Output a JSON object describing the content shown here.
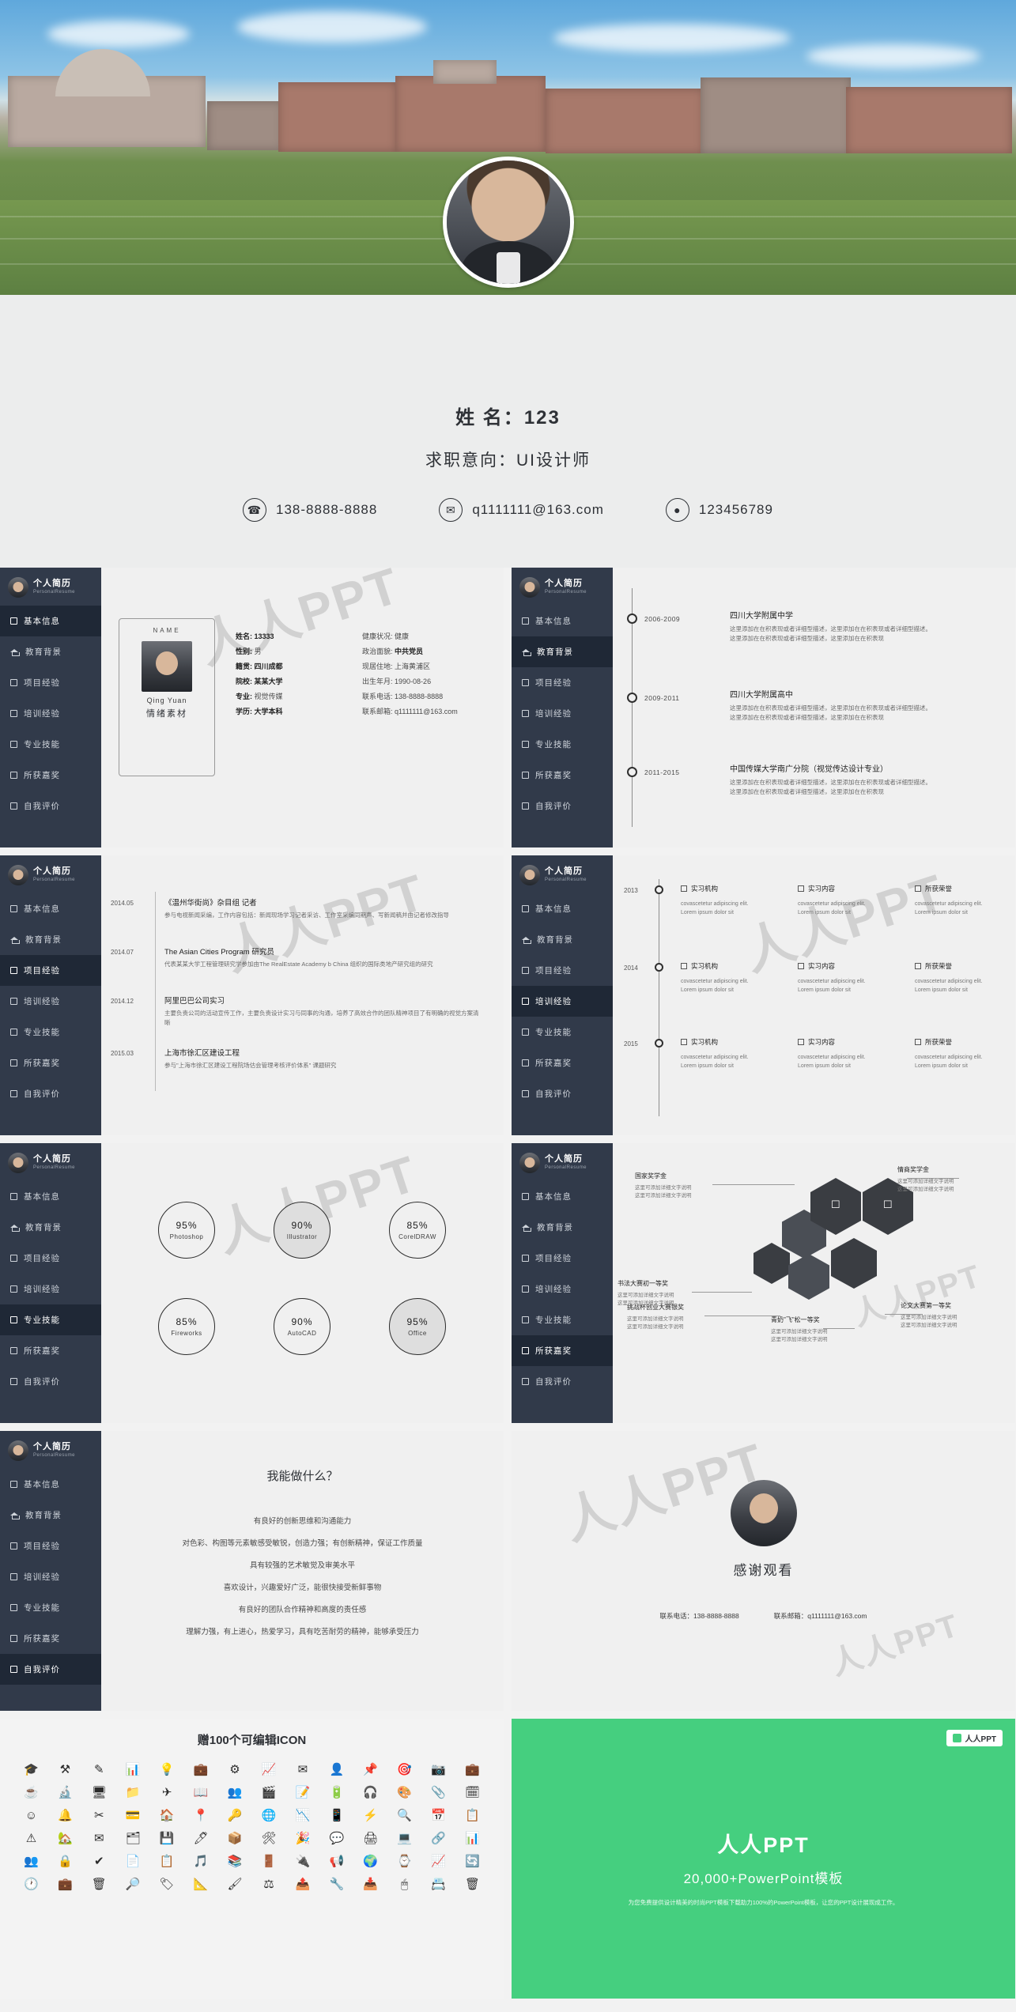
{
  "hero": {
    "name_label": "姓  名：",
    "name_value": "123",
    "role_label": "求职意向：",
    "role_value": "UI设计师",
    "contacts": [
      {
        "icon": "phone-icon",
        "glyph": "✆",
        "text": "138-8888-8888"
      },
      {
        "icon": "mail-icon",
        "glyph": "✉",
        "text": "q1111111@163.com"
      },
      {
        "icon": "qq-icon",
        "glyph": "●",
        "text": "123456789"
      }
    ]
  },
  "nav": {
    "brand_cn": "个人简历",
    "brand_en": "PersonalResume",
    "items": [
      {
        "label": "基本信息",
        "icon": "square-icon"
      },
      {
        "label": "教育背景",
        "icon": "graduation-cap-icon"
      },
      {
        "label": "项目经验",
        "icon": "square-icon"
      },
      {
        "label": "培训经验",
        "icon": "square-icon"
      },
      {
        "label": "专业技能",
        "icon": "square-icon"
      },
      {
        "label": "所获嘉奖",
        "icon": "square-icon"
      },
      {
        "label": "自我评价",
        "icon": "square-icon"
      }
    ]
  },
  "watermark": {
    "text": "人人PPT",
    "mark": "人人PPT"
  },
  "slide_basic": {
    "active": 0,
    "card": {
      "name_en": "NAME",
      "name_cn": "Qing Yuan",
      "subtitle": "情绪素材"
    },
    "left_fields": [
      {
        "label": "姓名:",
        "value": "13333"
      },
      {
        "label": "性别:",
        "value": "男"
      },
      {
        "label": "籍贯:",
        "value": "四川成都"
      },
      {
        "label": "院校:",
        "value": "某某大学"
      },
      {
        "label": "专业:",
        "value": "视觉传媒"
      },
      {
        "label": "学历:",
        "value": "大学本科"
      }
    ],
    "right_fields": [
      {
        "label": "健康状况:",
        "value": "健康"
      },
      {
        "label": "政治面貌:",
        "value": "中共党员"
      },
      {
        "label": "现居住地:",
        "value": "上海黄浦区"
      },
      {
        "label": "出生年月:",
        "value": "1990-08-26"
      },
      {
        "label": "联系电话:",
        "value": "138-8888-8888"
      },
      {
        "label": "联系邮箱:",
        "value": "q1111111@163.com"
      }
    ]
  },
  "slide_education": {
    "active": 1,
    "entries": [
      {
        "year": "2006-2009",
        "title": "四川大学附属中学",
        "desc": "这里添加在在积表现或者详细型描述，这里添加在在积表现或者详细型描述。\n这里添加在在积表现或者详细型描述，这里添加在在积表现"
      },
      {
        "year": "2009-2011",
        "title": "四川大学附属高中",
        "desc": "这里添加在在积表现或者详细型描述，这里添加在在积表现或者详细型描述。\n这里添加在在积表现或者详细型描述，这里添加在在积表现"
      },
      {
        "year": "2011-2015",
        "title": "中国传媒大学南广分院（视觉传达设计专业）",
        "desc": "这里添加在在积表现或者详细型描述，这里添加在在积表现或者详细型描述。\n这里添加在在积表现或者详细型描述，这里添加在在积表现"
      }
    ]
  },
  "slide_project": {
    "active": 2,
    "entries": [
      {
        "date": "2014.05",
        "title": "《温州华街尚》杂目组    记者",
        "desc": "参与电视新闻采编，工作内容包括：新闻现场学习记者采访、工作室采编同期声、写新闻稿并由记者修改指导"
      },
      {
        "date": "2014.07",
        "title": "The Asian Cities Program  研究员",
        "desc": "代表某某大学工程管理研究学参加由The RealEstate Academy b China 组织的国际类地产研究组的研究"
      },
      {
        "date": "2014.12",
        "title": "阿里巴巴公司实习",
        "desc": "主要负责公司的活动宣传工作，主要负责设计实习与同事的沟通，培养了高效合作的团队精神项目了有明确的视觉方案清晰"
      },
      {
        "date": "2015.03",
        "title": "上海市徐汇区建设工程",
        "desc": "参与\"上海市徐汇区建设工程院场估会管理考核评价体系\" 课题研究"
      }
    ]
  },
  "slide_training": {
    "active": 3,
    "years": [
      "2013",
      "2014",
      "2015"
    ],
    "columns": [
      "实习机构",
      "实习内容",
      "所获荣誉"
    ],
    "cell_text": "covascetetur adipiscing elit. Lorem ipsum dolor sit"
  },
  "slide_skills": {
    "active": 4,
    "items": [
      {
        "percent": "95%",
        "name": "Photoshop",
        "shade": false
      },
      {
        "percent": "90%",
        "name": "Illustrator",
        "shade": true
      },
      {
        "percent": "85%",
        "name": "CorelDRAW",
        "shade": false
      },
      {
        "percent": "85%",
        "name": "Fireworks",
        "shade": false
      },
      {
        "percent": "90%",
        "name": "AutoCAD",
        "shade": false
      },
      {
        "percent": "95%",
        "name": "Office",
        "shade": true
      }
    ]
  },
  "slide_awards": {
    "active": 5,
    "items": [
      {
        "title": "国家奖学金",
        "desc": "这里可添加详细文字说明\n这里可添加详细文字说明"
      },
      {
        "title": "情商奖学金",
        "desc": "这里可添加详细文字说明\n这里可添加详细文字说明"
      },
      {
        "title": "挑战杯创业大赛银奖",
        "desc": "这里可添加详细文字说明\n这里可添加详细文字说明"
      },
      {
        "title": "书法大赛初一等奖",
        "desc": "这里可添加详细文字说明\n这里可添加详细文字说明"
      },
      {
        "title": "青奶\"飞\"松一等奖",
        "desc": "这里可添加详细文字说明\n这里可添加详细文字说明"
      },
      {
        "title": "论文大赛第一等奖",
        "desc": "这里可添加详细文字说明\n这里可添加详细文字说明"
      }
    ]
  },
  "slide_self": {
    "active": 6,
    "heading": "我能做什么？",
    "lines": [
      "有良好的创新思维和沟通能力",
      "对色彩、构图等元素敏感受敏锐，创造力强；有创新精神，保证工作质量",
      "具有较强的艺术敏觉及审美水平",
      "喜欢设计，兴趣爱好广泛，能很快接受新鲜事物",
      "有良好的团队合作精神和高度的责任感",
      "理解力强，有上进心，热爱学习，具有吃苦耐劳的精神，能够承受压力"
    ]
  },
  "slide_thanks": {
    "heading": "感谢观看",
    "phone_label": "联系电话：",
    "phone_value": "138-8888-8888",
    "mail_label": "联系邮箱：",
    "mail_value": "q1111111@163.com"
  },
  "icons_panel": {
    "title": "赠100个可编辑ICON",
    "glyphs": [
      "🎓",
      "⚒",
      "✎",
      "📊",
      "💡",
      "💼",
      "⚙",
      "📈",
      "✉",
      "👤",
      "📌",
      "🎯",
      "📷",
      "💼",
      "☕",
      "🔬",
      "🖥",
      "📁",
      "✈",
      "📖",
      "👥",
      "🎬",
      "📝",
      "🔋",
      "🎧",
      "🎨",
      "📎",
      "🗓",
      "☺",
      "🔔",
      "✂",
      "💳",
      "🏠",
      "📍",
      "🔑",
      "🌐",
      "📉",
      "📱",
      "⚡",
      "🔍",
      "📅",
      "📋",
      "⚠",
      "🏡",
      "✉",
      "🗂",
      "💾",
      "🖊",
      "📦",
      "🛠",
      "🎉",
      "💬",
      "🖨",
      "💻",
      "🔗",
      "📊",
      "👥",
      "🔒",
      "✔",
      "📄",
      "📋",
      "🎵",
      "📚",
      "🚪",
      "🔌",
      "📢",
      "🌍",
      "⌚",
      "📈",
      "🔄",
      "🕐",
      "💼",
      "🗑",
      "🔎",
      "🏷",
      "📐",
      "🖌",
      "⚖",
      "📤",
      "🔧",
      "📥",
      "🖱",
      "📇",
      "🗑"
    ]
  },
  "green_panel": {
    "logo": "人人PPT",
    "title": "人人PPT",
    "subtitle": "20,000+PowerPoint模板",
    "desc": "为您免费提供设计精美的时尚PPT模板下载助力100%的PowerPoint模板，让您的PPT设计展现成工作。"
  }
}
